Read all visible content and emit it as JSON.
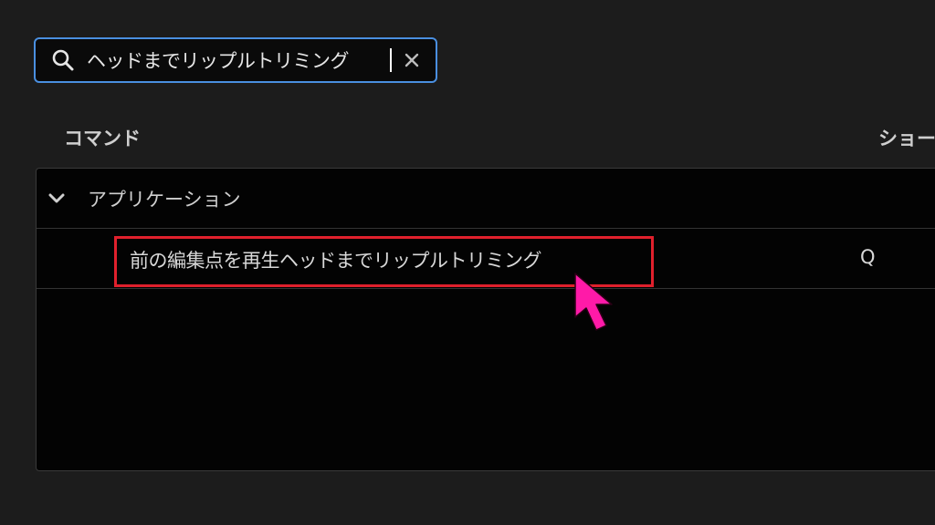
{
  "search": {
    "value": "ヘッドまでリップルトリミング",
    "icon": "search-icon",
    "clear_icon": "close-icon",
    "border_color": "#4a8fe0"
  },
  "columns": {
    "command": "コマンド",
    "shortcut": "ショー"
  },
  "groups": [
    {
      "label": "アプリケーション",
      "expanded": true,
      "items": [
        {
          "label": "前の編集点を再生ヘッドまでリップルトリミング",
          "shortcut": "Q",
          "highlighted": true
        }
      ]
    }
  ],
  "annotation": {
    "highlight_color": "#e0202c",
    "cursor_color": "#ff1aa8"
  }
}
